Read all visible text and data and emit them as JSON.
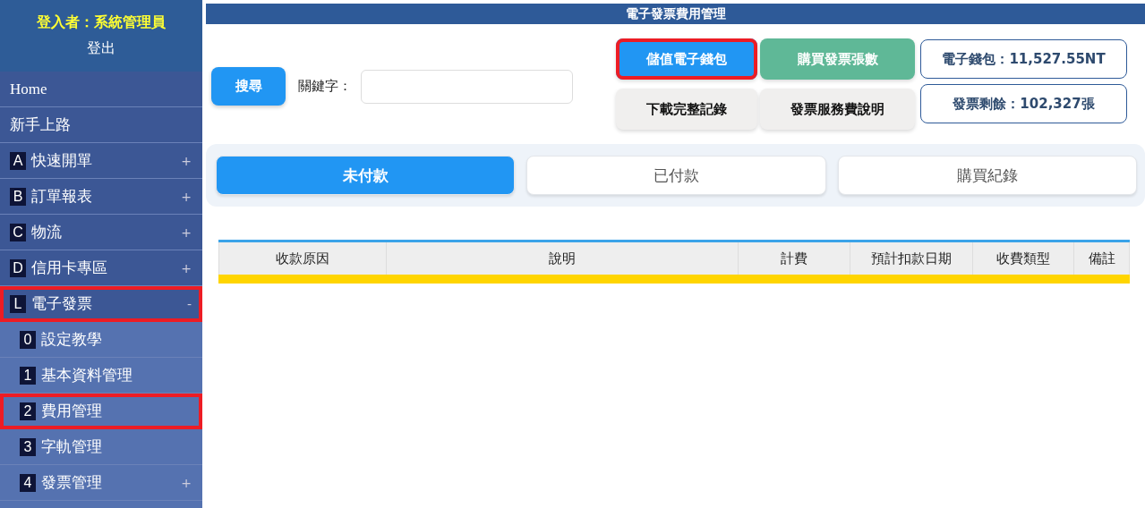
{
  "sidebar": {
    "user_label": "登入者：系統管理員",
    "logout": "登出",
    "items": [
      {
        "label": "Home",
        "highlighted": false
      },
      {
        "label": "新手上路",
        "highlighted": false
      },
      {
        "key": "A",
        "label": "快速開單",
        "expander": "+",
        "highlighted": false
      },
      {
        "key": "B",
        "label": "訂單報表",
        "expander": "+",
        "highlighted": false
      },
      {
        "key": "C",
        "label": "物流",
        "expander": "+",
        "highlighted": false
      },
      {
        "key": "D",
        "label": "信用卡專區",
        "expander": "+",
        "highlighted": false
      },
      {
        "key": "L",
        "label": "電子發票",
        "expander": "-",
        "highlighted": true,
        "children": [
          {
            "key": "0",
            "label": "設定教學",
            "highlighted": false
          },
          {
            "key": "1",
            "label": "基本資料管理",
            "highlighted": false
          },
          {
            "key": "2",
            "label": "費用管理",
            "highlighted": true
          },
          {
            "key": "3",
            "label": "字軌管理",
            "highlighted": false
          },
          {
            "key": "4",
            "label": "發票管理",
            "expander": "+",
            "highlighted": false
          }
        ]
      }
    ]
  },
  "page_title": "電子發票費用管理",
  "search": {
    "button": "搜尋",
    "label": "關鍵字："
  },
  "actions": [
    {
      "label": "儲值電子錢包",
      "kind": "primary",
      "highlighted": true
    },
    {
      "label": "購買發票張數",
      "kind": "success",
      "highlighted": false
    },
    {
      "label": "下載完整記錄",
      "kind": "plain",
      "highlighted": false
    },
    {
      "label": "發票服務費說明",
      "kind": "plain",
      "highlighted": false
    }
  ],
  "info": [
    "電子錢包：11,527.55NT",
    "發票剩餘：102,327張"
  ],
  "tabs": [
    {
      "label": "未付款",
      "selected": true
    },
    {
      "label": "已付款",
      "selected": false
    },
    {
      "label": "購買紀錄",
      "selected": false
    }
  ],
  "table": {
    "columns": [
      "收款原因",
      "說明",
      "計費",
      "預計扣款日期",
      "收費類型",
      "備註"
    ]
  }
}
